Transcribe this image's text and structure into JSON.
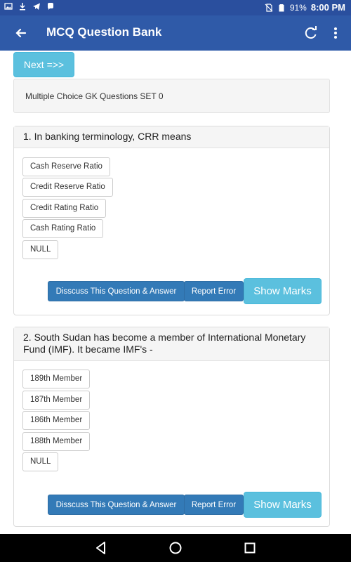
{
  "status_bar": {
    "battery": "91%",
    "time": "8:00 PM"
  },
  "app_bar": {
    "title": "MCQ Question Bank"
  },
  "next_button": "Next =>>",
  "set_title": "Multiple Choice GK Questions SET 0",
  "questions": [
    {
      "question": "1. In banking terminology, CRR means",
      "options": [
        "Cash Reserve Ratio",
        "Credit Reserve Ratio",
        "Credit Rating Ratio",
        "Cash Rating Ratio",
        "NULL"
      ],
      "discuss_label": "Disscuss This Question & Answer",
      "report_label": "Report Error",
      "marks_label": "Show Marks"
    },
    {
      "question": "2. South Sudan has become a member of International Monetary Fund (IMF). It became IMF's -",
      "options": [
        "189th Member",
        "187th Member",
        "186th Member",
        "188th Member",
        "NULL"
      ],
      "discuss_label": "Disscuss This Question & Answer",
      "report_label": "Report Error",
      "marks_label": "Show Marks"
    }
  ],
  "colors": {
    "status_bar": "#2a4f9e",
    "app_bar": "#2f5aa8",
    "info_button": "#5bc0de",
    "primary_button": "#337ab7"
  }
}
